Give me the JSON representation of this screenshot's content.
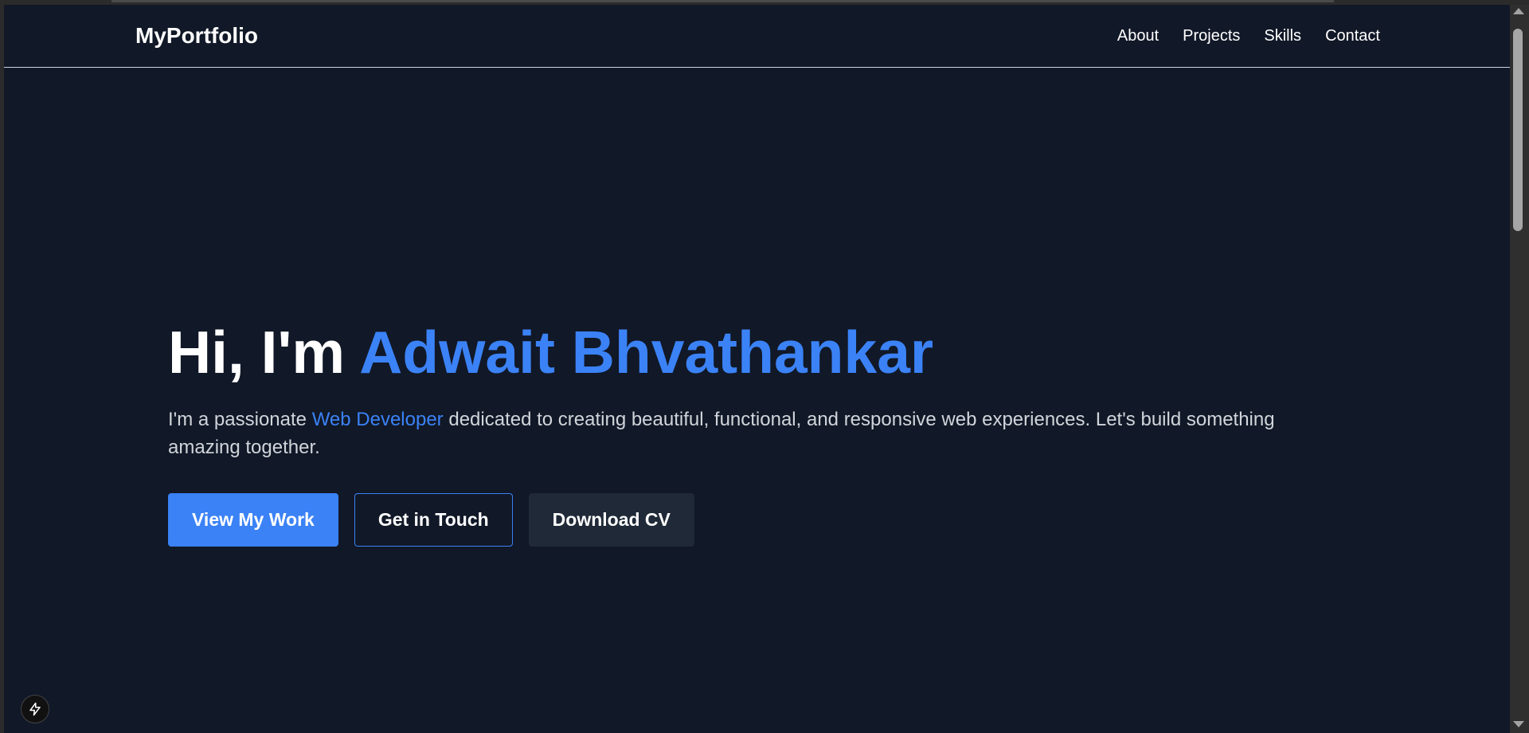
{
  "nav": {
    "logo": "MyPortfolio",
    "links": [
      "About",
      "Projects",
      "Skills",
      "Contact"
    ]
  },
  "hero": {
    "title_prefix": "Hi, I'm ",
    "title_name": "Adwait Bhvathankar",
    "desc_before": "I'm a passionate ",
    "desc_highlight": "Web Developer",
    "desc_after": " dedicated to creating beautiful, functional, and responsive web experiences. Let's build something amazing together.",
    "buttons": {
      "primary": "View My Work",
      "secondary": "Get in Touch",
      "tertiary": "Download CV"
    }
  },
  "colors": {
    "background": "#111827",
    "accent": "#3b82f6",
    "text": "#ffffff",
    "muted_text": "#d1d5db",
    "dark_button": "#1f2937"
  },
  "icons": {
    "badge": "lightning-icon",
    "scroll_up": "scroll-up-arrow-icon",
    "scroll_down": "scroll-down-arrow-icon"
  }
}
